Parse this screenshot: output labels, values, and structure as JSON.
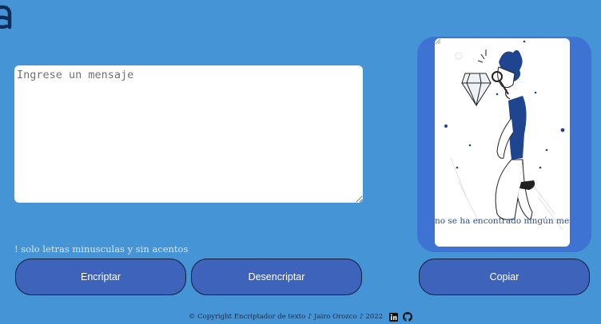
{
  "input": {
    "placeholder": "Ingrese un mensaje",
    "value": ""
  },
  "hint": {
    "text": "! solo letras minusculas y sin acentos"
  },
  "buttons": {
    "encrypt_label": "Encriptar",
    "decrypt_label": "Desencriptar",
    "copy_label": "Copiar"
  },
  "output": {
    "empty_text": "no se ha encontrado ningún mensaje"
  },
  "footer": {
    "copyright": "© Copyright Encriptador de texto ♪ Jairo Orozco ♪ 2022",
    "icons": [
      "linkedin-icon",
      "github-icon"
    ]
  },
  "colors": {
    "background": "#4595d6",
    "button": "#3d63ba",
    "panel": "#3e72d3",
    "accent": "#1f4590"
  }
}
